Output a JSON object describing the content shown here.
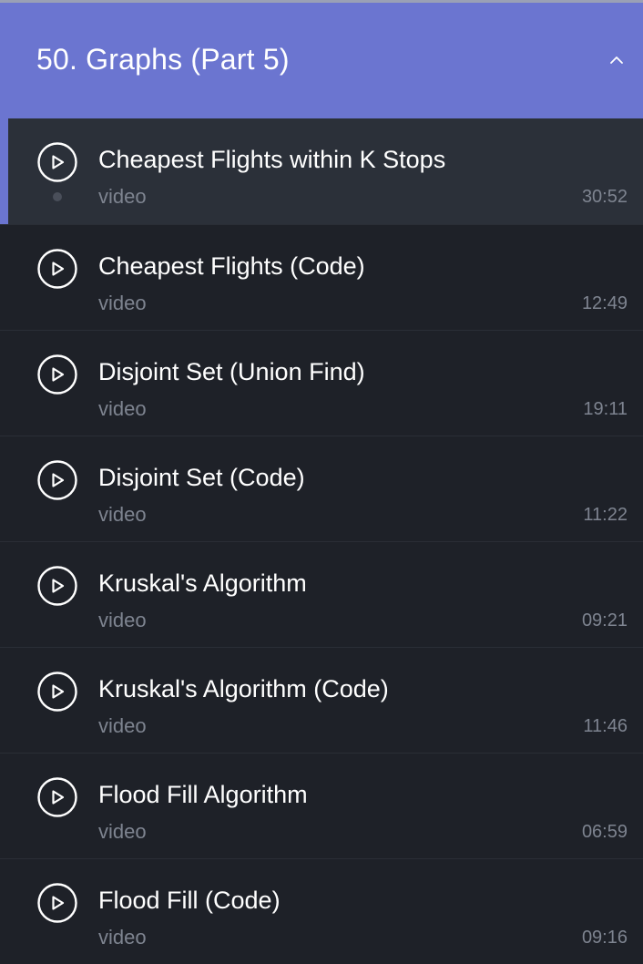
{
  "section": {
    "title": "50. Graphs (Part 5)",
    "expanded_icon": "chevron-up-icon"
  },
  "colors": {
    "header_bg": "#6b75d0",
    "list_bg": "#1e2128",
    "active_bg": "#2b3039",
    "muted_text": "#7e8490"
  },
  "lessons": [
    {
      "title": "Cheapest Flights within K Stops",
      "type": "video",
      "duration": "30:52",
      "active": true
    },
    {
      "title": "Cheapest Flights (Code)",
      "type": "video",
      "duration": "12:49",
      "active": false
    },
    {
      "title": "Disjoint Set (Union Find)",
      "type": "video",
      "duration": "19:11",
      "active": false
    },
    {
      "title": "Disjoint Set (Code)",
      "type": "video",
      "duration": "11:22",
      "active": false
    },
    {
      "title": "Kruskal's Algorithm",
      "type": "video",
      "duration": "09:21",
      "active": false
    },
    {
      "title": "Kruskal's Algorithm (Code)",
      "type": "video",
      "duration": "11:46",
      "active": false
    },
    {
      "title": "Flood Fill Algorithm",
      "type": "video",
      "duration": "06:59",
      "active": false
    },
    {
      "title": "Flood Fill (Code)",
      "type": "video",
      "duration": "09:16",
      "active": false
    }
  ]
}
